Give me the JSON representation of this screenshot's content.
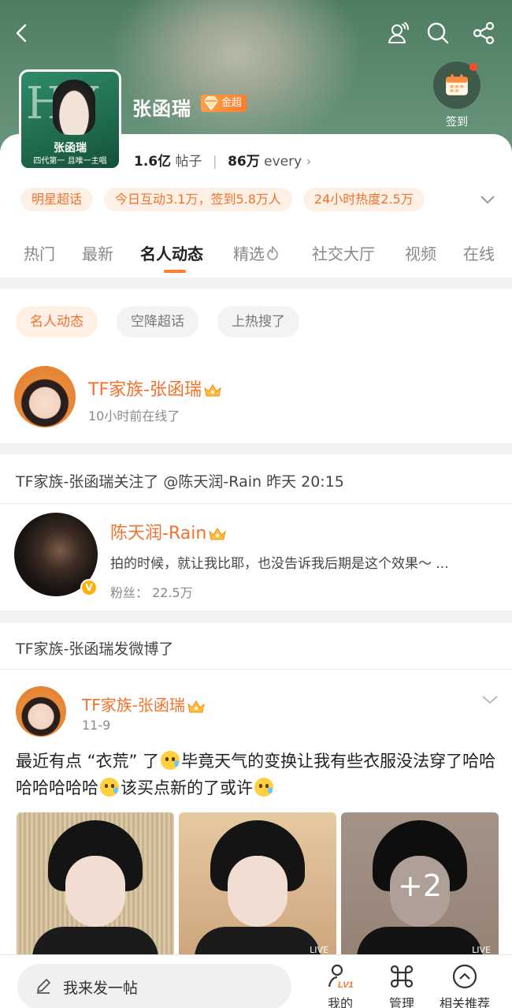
{
  "header": {
    "title": "张函瑞",
    "super_badge": "金超",
    "checkin_label": "签到",
    "posts_count": "1.6亿",
    "posts_label": "帖子",
    "members_count": "86万",
    "members_label": "every",
    "cover": {
      "big_letters": "HY",
      "name": "张函瑞",
      "subtitle": "四代第一 且唯一主唱"
    }
  },
  "chips": [
    "明星超话",
    "今日互动3.1万，签到5.8万人",
    "24小时热度2.5万"
  ],
  "tabs": [
    "热门",
    "最新",
    "名人动态",
    "精选",
    "社交大厅",
    "视频",
    "在线"
  ],
  "active_tab": "名人动态",
  "filters": [
    "名人动态",
    "空降超话",
    "上热搜了"
  ],
  "celebrity": {
    "name": "TF家族-张函瑞",
    "status": "10小时前在线了"
  },
  "follow_event": {
    "headline": "TF家族-张函瑞关注了 @陈天润-Rain 昨天 20:15",
    "user_name": "陈天润-Rain",
    "bio": "拍的时候，就让我比耶，也没告诉我后期是这个效果～ ...",
    "fans": "粉丝： 22.5万"
  },
  "post_event": {
    "headline": "TF家族-张函瑞发微博了",
    "author": "TF家族-张函瑞",
    "date": "11-9",
    "text_1": "最近有点 “衣荒” 了",
    "text_2": "毕竟天气的变换让我有些衣服没法穿了哈哈哈哈哈哈哈",
    "text_3": "该买点新的了或许",
    "more_images": "+2",
    "live_label": "LIVE"
  },
  "bottom_bar": {
    "compose_placeholder": "我来发一帖",
    "mine": "我的",
    "mine_badge": "LV1",
    "manage": "管理",
    "recommend": "相关推荐"
  },
  "colors": {
    "accent": "#f2722d",
    "chip_bg": "#fff0e6",
    "header_green": "#5c8a6e"
  }
}
